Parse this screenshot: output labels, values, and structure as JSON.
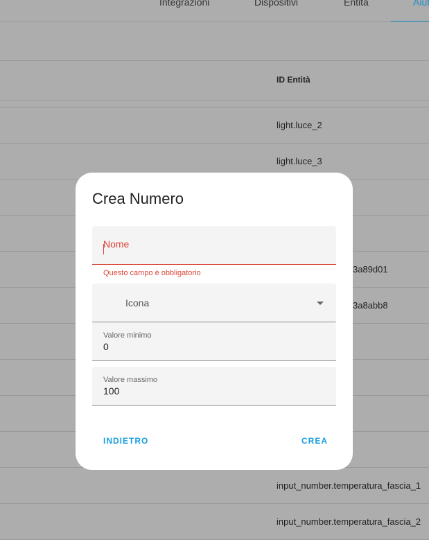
{
  "tabs": [
    "Integrazioni",
    "Dispositivi",
    "Entità",
    "Aiuti"
  ],
  "table": {
    "header": "ID Entità",
    "rows": [
      "light.luce_2",
      "light.luce_3",
      "",
      "",
      "3a89d01",
      "3a8abb8",
      "",
      "",
      "",
      "",
      "input_number.temperatura_fascia_1",
      "input_number.temperatura_fascia_2"
    ]
  },
  "dialog": {
    "title": "Crea Numero",
    "name_label": "Nome",
    "name_error": "Questo campo è obbligatorio",
    "icon_label": "Icona",
    "min_label": "Valore minimo",
    "min_value": "0",
    "max_label": "Valore massimo",
    "max_value": "100",
    "back": "INDIETRO",
    "create": "CREA"
  }
}
